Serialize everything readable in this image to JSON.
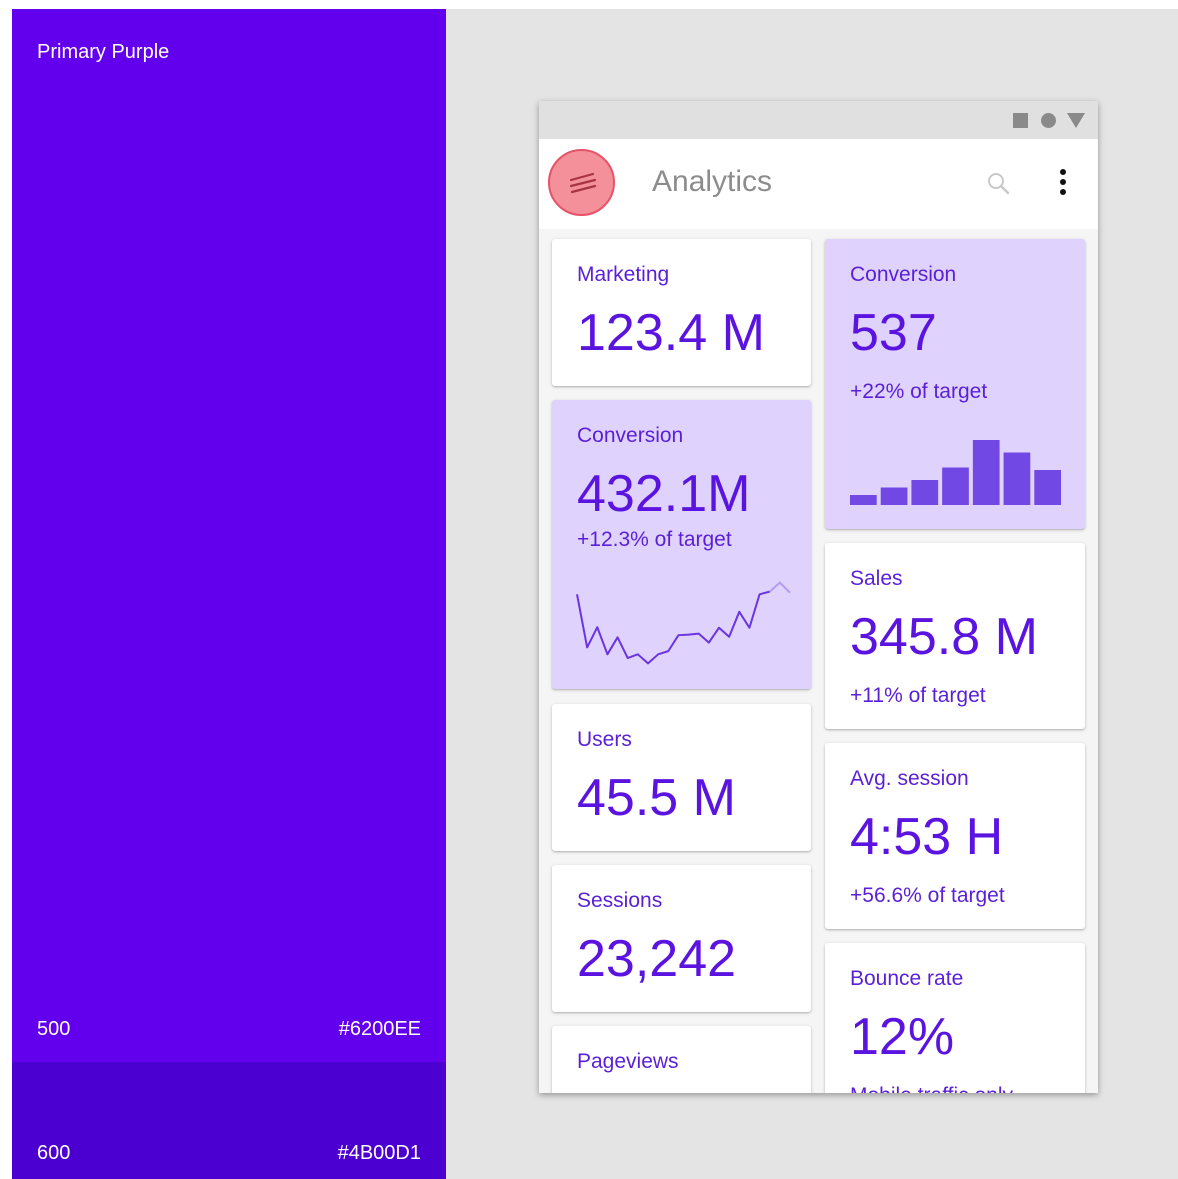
{
  "palette": {
    "title": "Primary Purple",
    "shades": [
      {
        "shade": "500",
        "hex": "#6200EE"
      },
      {
        "shade": "600",
        "hex": "#4B00D1"
      }
    ]
  },
  "statusbar": {
    "icons": [
      "stop-square-icon",
      "record-circle-icon",
      "signal-triangle-icon"
    ]
  },
  "appbar": {
    "title": "Analytics",
    "icons": {
      "menu": "menu-lines-icon",
      "search": "search-icon",
      "more": "more-vertical-icon"
    }
  },
  "cards": {
    "marketing": {
      "label": "Marketing",
      "value": "123.4 M"
    },
    "conversion_bars": {
      "label": "Conversion",
      "value": "537",
      "sub": "+22% of target",
      "chart_data": {
        "type": "bar",
        "values": [
          2,
          3.5,
          5,
          7.5,
          13,
          10.5,
          7
        ],
        "ylim": [
          0,
          14
        ],
        "color": "#7248E5"
      }
    },
    "conversion_line": {
      "label": "Conversion",
      "value": "432.1M",
      "sub": "+12.3% of target",
      "chart_data": {
        "type": "line",
        "values": [
          13.5,
          3.5,
          7.3,
          2.2,
          5.4,
          1.5,
          2.2,
          0.5,
          2.2,
          2.8,
          5.8,
          5.9,
          6.1,
          4.4,
          7.2,
          5.5,
          10.2,
          7.2,
          13.5,
          14.0,
          15.7,
          13.8
        ],
        "ylim": [
          0,
          16
        ],
        "color": "#6a35e0",
        "faded_tail_color": "#b19cf0"
      }
    },
    "sales": {
      "label": "Sales",
      "value": "345.8 M",
      "sub": "+11% of target"
    },
    "users": {
      "label": "Users",
      "value": "45.5 M"
    },
    "avg_session": {
      "label": "Avg. session",
      "value": "4:53 H",
      "sub": "+56.6% of target"
    },
    "sessions": {
      "label": "Sessions",
      "value": "23,242"
    },
    "bounce_rate": {
      "label": "Bounce rate",
      "value": "12%",
      "sub": "Mobile traffic only"
    },
    "pageviews": {
      "label": "Pageviews"
    }
  }
}
